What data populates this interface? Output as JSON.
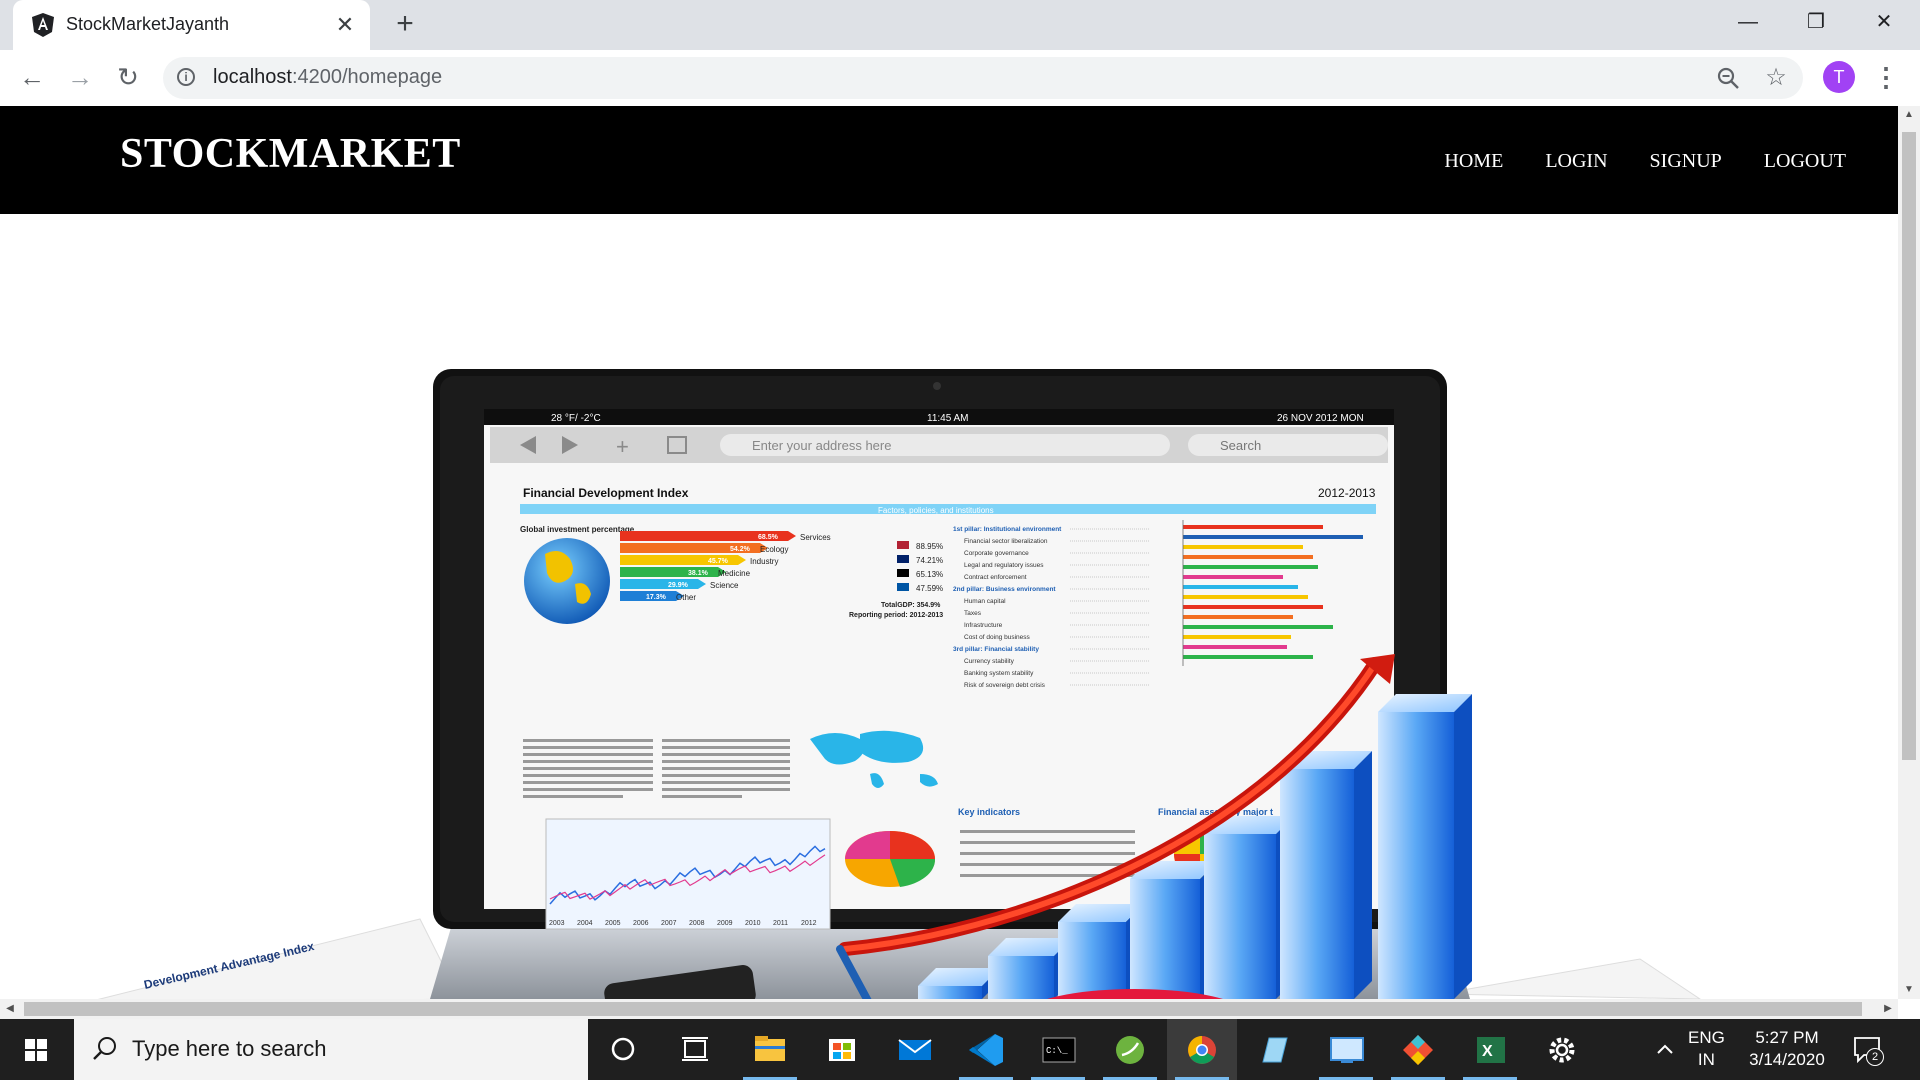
{
  "browser": {
    "tab_title": "StockMarketJayanth",
    "url_host": "localhost",
    "url_path": ":4200/homepage",
    "profile_initial": "T"
  },
  "site": {
    "brand": "STOCKMARKET",
    "nav": [
      "HOME",
      "LOGIN",
      "SIGNUP",
      "LOGOUT"
    ]
  },
  "hero": {
    "status_left": "28 °F/ -2°C",
    "status_time": "11:45 AM",
    "status_date": "26 NOV 2012 MON",
    "address_placeholder": "Enter your address here",
    "search_label": "Search",
    "doc_title": "Financial Development Index",
    "doc_year": "2012-2013",
    "doc_subtitle": "Factors, policies, and institutions",
    "global_label": "Global investment percentage",
    "bars": [
      {
        "pct": "68.5%",
        "label": "Services",
        "color": "#e8321e"
      },
      {
        "pct": "54.2%",
        "label": "Ecology",
        "color": "#f36f21"
      },
      {
        "pct": "45.7%",
        "label": "Industry",
        "color": "#f7c600"
      },
      {
        "pct": "38.1%",
        "label": "Medicine",
        "color": "#2db34a"
      },
      {
        "pct": "29.9%",
        "label": "Science",
        "color": "#29b5e8"
      },
      {
        "pct": "17.3%",
        "label": "Other",
        "color": "#1e7fd6"
      }
    ],
    "flags": [
      "88.95%",
      "74.21%",
      "65.13%",
      "47.59%"
    ],
    "total_gdp": "TotalGDP: 354.9%",
    "period": "Reporting period: 2012-2013",
    "pillars": [
      "1st pillar: Institutional environment",
      "Financial sector liberalization",
      "Corporate governance",
      "Legal and regulatory issues",
      "Contract enforcement",
      "2nd pillar: Business environment",
      "Human capital",
      "Taxes",
      "Infrastructure",
      "Cost of doing business",
      "3rd pillar: Financial stability",
      "Currency stability",
      "Banking system stability",
      "Risk of sovereign debt crisis"
    ],
    "key_indicators": "Key indicators",
    "financial_assets": "Financial assets by major t",
    "years": [
      "2003",
      "2004",
      "2005",
      "2006",
      "2007",
      "2008",
      "2009",
      "2010",
      "2011",
      "2012"
    ],
    "paper_title": "Development Advantage Index"
  },
  "taskbar": {
    "search_placeholder": "Type here to search",
    "lang_top": "ENG",
    "lang_bottom": "IN",
    "time": "5:27 PM",
    "date": "3/14/2020",
    "notifications": "2"
  }
}
